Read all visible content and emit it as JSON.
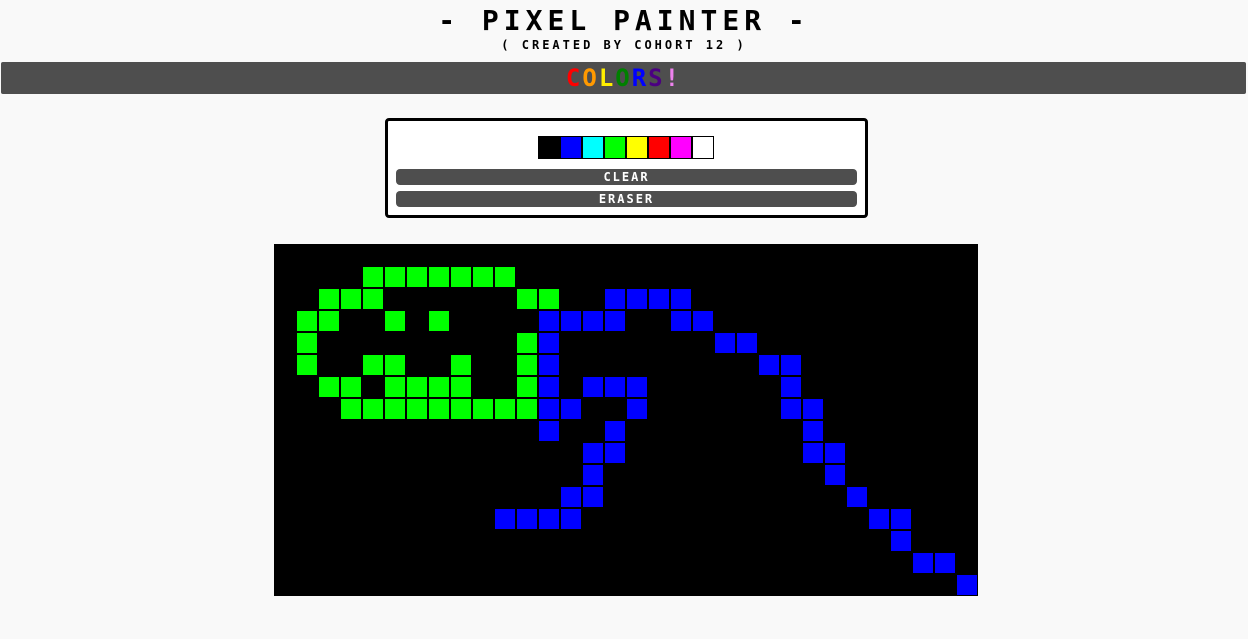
{
  "header": {
    "title": "- PIXEL PAINTER -",
    "subtitle": "( CREATED BY COHORT 12 )"
  },
  "colors_banner": {
    "letters": [
      {
        "char": "C",
        "color": "#ff0000"
      },
      {
        "char": "O",
        "color": "#ff9900"
      },
      {
        "char": "L",
        "color": "#ffee00"
      },
      {
        "char": "O",
        "color": "#008000"
      },
      {
        "char": "R",
        "color": "#0000ff"
      },
      {
        "char": "S",
        "color": "#4b0082"
      },
      {
        "char": "!",
        "color": "#ee82ee"
      }
    ]
  },
  "palette": {
    "swatches": [
      {
        "name": "black",
        "color": "#000000"
      },
      {
        "name": "blue",
        "color": "#0000ff"
      },
      {
        "name": "cyan",
        "color": "#00ffff"
      },
      {
        "name": "lime",
        "color": "#00ff00"
      },
      {
        "name": "yellow",
        "color": "#ffff00"
      },
      {
        "name": "red",
        "color": "#ff0000"
      },
      {
        "name": "magenta",
        "color": "#ff00ff"
      },
      {
        "name": "white",
        "color": "#ffffff"
      }
    ],
    "clear_label": "CLEAR",
    "eraser_label": "ERASER"
  },
  "canvas": {
    "grid_columns": 32,
    "grid_rows": 16,
    "background": "#000000",
    "painted": {
      "#00ff00": [
        [
          1,
          4
        ],
        [
          1,
          5
        ],
        [
          1,
          6
        ],
        [
          1,
          7
        ],
        [
          1,
          8
        ],
        [
          1,
          9
        ],
        [
          1,
          10
        ],
        [
          2,
          2
        ],
        [
          2,
          3
        ],
        [
          2,
          4
        ],
        [
          2,
          11
        ],
        [
          2,
          12
        ],
        [
          3,
          1
        ],
        [
          3,
          2
        ],
        [
          3,
          5
        ],
        [
          3,
          7
        ],
        [
          4,
          1
        ],
        [
          4,
          11
        ],
        [
          5,
          1
        ],
        [
          5,
          4
        ],
        [
          5,
          5
        ],
        [
          5,
          8
        ],
        [
          5,
          11
        ],
        [
          6,
          2
        ],
        [
          6,
          3
        ],
        [
          6,
          5
        ],
        [
          6,
          6
        ],
        [
          6,
          7
        ],
        [
          6,
          8
        ],
        [
          6,
          11
        ],
        [
          7,
          3
        ],
        [
          7,
          4
        ],
        [
          7,
          5
        ],
        [
          7,
          6
        ],
        [
          7,
          7
        ],
        [
          7,
          8
        ],
        [
          7,
          9
        ],
        [
          7,
          10
        ],
        [
          7,
          11
        ]
      ],
      "#0000ff": [
        [
          2,
          15
        ],
        [
          2,
          16
        ],
        [
          2,
          17
        ],
        [
          2,
          18
        ],
        [
          3,
          12
        ],
        [
          3,
          13
        ],
        [
          3,
          14
        ],
        [
          3,
          15
        ],
        [
          3,
          18
        ],
        [
          3,
          19
        ],
        [
          4,
          12
        ],
        [
          4,
          20
        ],
        [
          4,
          21
        ],
        [
          5,
          12
        ],
        [
          5,
          22
        ],
        [
          5,
          23
        ],
        [
          6,
          12
        ],
        [
          6,
          14
        ],
        [
          6,
          15
        ],
        [
          6,
          16
        ],
        [
          6,
          23
        ],
        [
          7,
          12
        ],
        [
          7,
          13
        ],
        [
          7,
          16
        ],
        [
          7,
          23
        ],
        [
          7,
          24
        ],
        [
          8,
          12
        ],
        [
          8,
          15
        ],
        [
          8,
          24
        ],
        [
          9,
          14
        ],
        [
          9,
          15
        ],
        [
          9,
          24
        ],
        [
          9,
          25
        ],
        [
          10,
          14
        ],
        [
          10,
          25
        ],
        [
          11,
          13
        ],
        [
          11,
          14
        ],
        [
          11,
          26
        ],
        [
          12,
          10
        ],
        [
          12,
          11
        ],
        [
          12,
          12
        ],
        [
          12,
          13
        ],
        [
          12,
          27
        ],
        [
          12,
          28
        ],
        [
          13,
          28
        ],
        [
          14,
          29
        ],
        [
          14,
          30
        ],
        [
          15,
          31
        ]
      ]
    }
  }
}
